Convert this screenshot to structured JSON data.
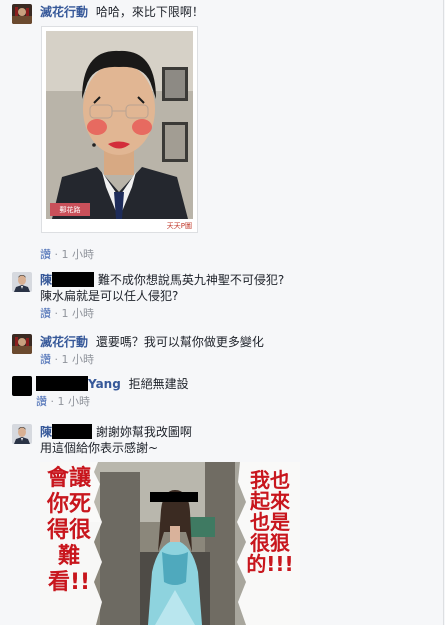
{
  "comments": [
    {
      "author": "滅花行動",
      "text": "哈哈，來比下限啊！",
      "image": {
        "sticker_label": "郵花路",
        "watermark": "天天P圖"
      },
      "like_label": "讚",
      "time": "1 小時"
    },
    {
      "author": "陳",
      "text_line1": "難不成你想說馬英九神聖不可侵犯?",
      "text_line2": "陳水扁就是可以任人侵犯?",
      "like_label": "讚",
      "time": "1 小時"
    },
    {
      "author": "滅花行動",
      "text": "還要嗎？我可以幫你做更多變化",
      "like_label": "讚",
      "time": "1 小時"
    },
    {
      "author": "Yang",
      "text": "拒絕無建設",
      "like_label": "讚",
      "time": "1 小時"
    },
    {
      "author": "陳",
      "text_line1": "謝謝妳幫我改圖啊",
      "text_line2": "用這個給你表示感謝~",
      "image": {
        "left_text": "會讓你死得很難看!!",
        "right_text": "我也起來也是很狠的!!!"
      }
    }
  ],
  "separator": "·",
  "colors": {
    "link": "#365899",
    "like": "#4267b2",
    "meta": "#90949c",
    "banner_red": "#c8161d"
  }
}
